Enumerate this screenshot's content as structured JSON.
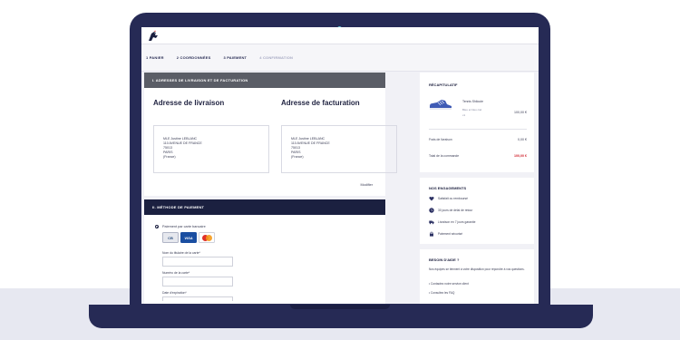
{
  "steps": [
    {
      "label": "1 PANIER"
    },
    {
      "label": "2 COORDONNÉES"
    },
    {
      "label": "3 PAIEMENT"
    },
    {
      "label": "4 CONFIRMATION"
    }
  ],
  "address_section": {
    "header": "I. ADRESSES DE LIVRAISON ET DE FACTURATION",
    "delivery_title": "Adresse de livraison",
    "billing_title": "Adresse de facturation",
    "delivery_lines": [
      "MLE Justine LEBLANC",
      "110 AVENUE DE FRANCE",
      "75013",
      "PARIS",
      "(France)"
    ],
    "billing_lines": [
      "MLE Justine LEBLANC",
      "110 AVENUE DE FRANCE",
      "75013",
      "PARIS",
      "(France)"
    ],
    "modify_label": "Modifier"
  },
  "payment_section": {
    "header": "II. MÉTHODE DE PAIEMENT",
    "method_label": "Paiement par carte bancaire",
    "cards": {
      "cb": "CB",
      "visa": "VISA",
      "mastercard": "mastercard"
    },
    "fields": [
      {
        "label": "Nom du titulaire de la carte*"
      },
      {
        "label": "Numéro de la carte*"
      },
      {
        "label": "Date d'expiration*"
      }
    ]
  },
  "summary": {
    "title": "RÉCAPITULATIF",
    "product_name": "Tennis Shiloute",
    "product_meta": "Bleu et bleu ciel",
    "product_qty": "x1",
    "product_price": "100,00 €",
    "shipping_label": "Frais de livraison",
    "shipping_value": "0,00 €",
    "total_label": "Total de la commande",
    "total_value": "100,00 €",
    "total_color": "#d1242f"
  },
  "engagements": {
    "title": "NOS ENGAGEMENTS",
    "items": [
      {
        "icon": "heart-icon",
        "label": "Satisfait ou remboursé"
      },
      {
        "icon": "clock-icon",
        "label": "30 jours de délai de retour"
      },
      {
        "icon": "truck-icon",
        "label": "Livraison en 7 jours garantie"
      },
      {
        "icon": "lock-icon",
        "label": "Paiement sécurisé"
      }
    ]
  },
  "help": {
    "title": "BESOIN D'AIDE ?",
    "text": "Nos équipes se tiennent à votre disposition pour répondre à vos questions.",
    "links": [
      "Contactez notre service client",
      "Consultez les FAQ"
    ]
  },
  "colors": {
    "navy": "#1b2040",
    "grey_header": "#5a5d66",
    "laptop": "#262a55",
    "camera": "#63c4d3"
  }
}
